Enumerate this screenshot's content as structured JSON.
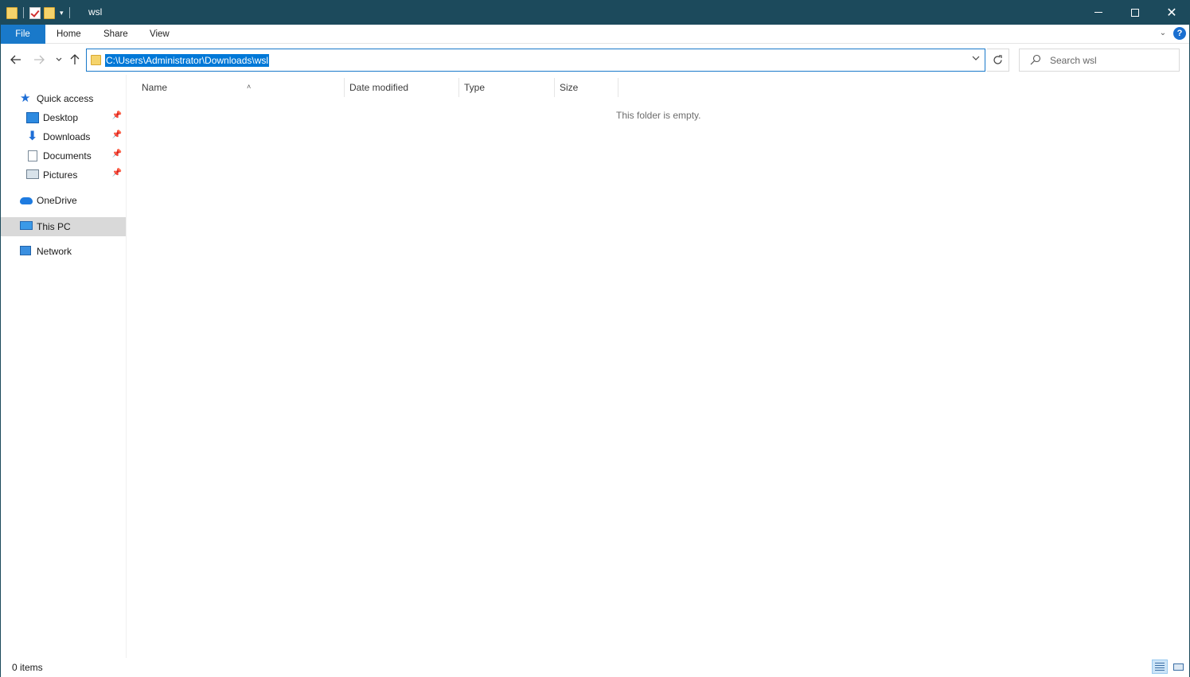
{
  "window": {
    "title": "wsl",
    "minimize_glyph": "",
    "maximize_glyph": "",
    "close_glyph": "✕"
  },
  "ribbon": {
    "tabs": [
      "File",
      "Home",
      "Share",
      "View"
    ],
    "help_glyph": "?"
  },
  "navigation": {
    "address": "C:\\Users\\Administrator\\Downloads\\wsl",
    "search_placeholder": "Search wsl"
  },
  "sidebar": {
    "items": [
      {
        "label": "Quick access",
        "icon": "star-icon"
      },
      {
        "label": "Desktop",
        "icon": "desktop-icon",
        "pinned": true
      },
      {
        "label": "Downloads",
        "icon": "download-icon",
        "pinned": true
      },
      {
        "label": "Documents",
        "icon": "documents-icon",
        "pinned": true
      },
      {
        "label": "Pictures",
        "icon": "pictures-icon",
        "pinned": true
      },
      {
        "label": "OneDrive",
        "icon": "cloud-icon"
      },
      {
        "label": "This PC",
        "icon": "computer-icon",
        "selected": true
      },
      {
        "label": "Network",
        "icon": "network-icon"
      }
    ]
  },
  "content": {
    "columns": [
      "Name",
      "Date modified",
      "Type",
      "Size"
    ],
    "empty_message": "This folder is empty."
  },
  "status": {
    "item_count": "0 items"
  },
  "colors": {
    "titlebar": "#1c4a5c",
    "file_tab": "#1979ca",
    "selection": "#0078d7",
    "selected_nav": "#d9d9d9"
  }
}
